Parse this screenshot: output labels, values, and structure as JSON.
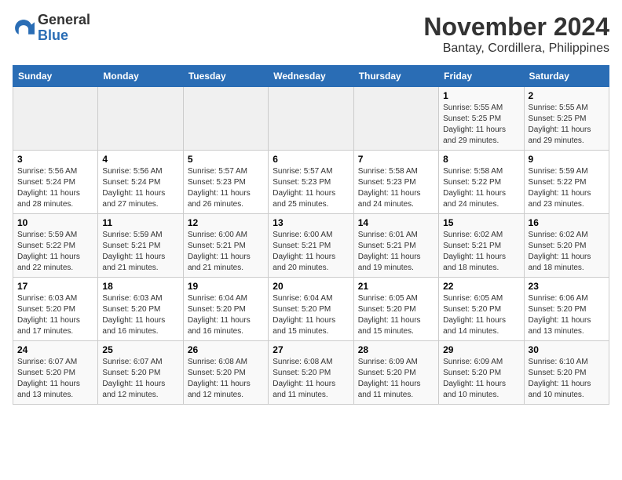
{
  "logo": {
    "general": "General",
    "blue": "Blue"
  },
  "title": {
    "month_year": "November 2024",
    "location": "Bantay, Cordillera, Philippines"
  },
  "weekdays": [
    "Sunday",
    "Monday",
    "Tuesday",
    "Wednesday",
    "Thursday",
    "Friday",
    "Saturday"
  ],
  "weeks": [
    [
      {
        "day": "",
        "info": ""
      },
      {
        "day": "",
        "info": ""
      },
      {
        "day": "",
        "info": ""
      },
      {
        "day": "",
        "info": ""
      },
      {
        "day": "",
        "info": ""
      },
      {
        "day": "1",
        "info": "Sunrise: 5:55 AM\nSunset: 5:25 PM\nDaylight: 11 hours and 29 minutes."
      },
      {
        "day": "2",
        "info": "Sunrise: 5:55 AM\nSunset: 5:25 PM\nDaylight: 11 hours and 29 minutes."
      }
    ],
    [
      {
        "day": "3",
        "info": "Sunrise: 5:56 AM\nSunset: 5:24 PM\nDaylight: 11 hours and 28 minutes."
      },
      {
        "day": "4",
        "info": "Sunrise: 5:56 AM\nSunset: 5:24 PM\nDaylight: 11 hours and 27 minutes."
      },
      {
        "day": "5",
        "info": "Sunrise: 5:57 AM\nSunset: 5:23 PM\nDaylight: 11 hours and 26 minutes."
      },
      {
        "day": "6",
        "info": "Sunrise: 5:57 AM\nSunset: 5:23 PM\nDaylight: 11 hours and 25 minutes."
      },
      {
        "day": "7",
        "info": "Sunrise: 5:58 AM\nSunset: 5:23 PM\nDaylight: 11 hours and 24 minutes."
      },
      {
        "day": "8",
        "info": "Sunrise: 5:58 AM\nSunset: 5:22 PM\nDaylight: 11 hours and 24 minutes."
      },
      {
        "day": "9",
        "info": "Sunrise: 5:59 AM\nSunset: 5:22 PM\nDaylight: 11 hours and 23 minutes."
      }
    ],
    [
      {
        "day": "10",
        "info": "Sunrise: 5:59 AM\nSunset: 5:22 PM\nDaylight: 11 hours and 22 minutes."
      },
      {
        "day": "11",
        "info": "Sunrise: 5:59 AM\nSunset: 5:21 PM\nDaylight: 11 hours and 21 minutes."
      },
      {
        "day": "12",
        "info": "Sunrise: 6:00 AM\nSunset: 5:21 PM\nDaylight: 11 hours and 21 minutes."
      },
      {
        "day": "13",
        "info": "Sunrise: 6:00 AM\nSunset: 5:21 PM\nDaylight: 11 hours and 20 minutes."
      },
      {
        "day": "14",
        "info": "Sunrise: 6:01 AM\nSunset: 5:21 PM\nDaylight: 11 hours and 19 minutes."
      },
      {
        "day": "15",
        "info": "Sunrise: 6:02 AM\nSunset: 5:21 PM\nDaylight: 11 hours and 18 minutes."
      },
      {
        "day": "16",
        "info": "Sunrise: 6:02 AM\nSunset: 5:20 PM\nDaylight: 11 hours and 18 minutes."
      }
    ],
    [
      {
        "day": "17",
        "info": "Sunrise: 6:03 AM\nSunset: 5:20 PM\nDaylight: 11 hours and 17 minutes."
      },
      {
        "day": "18",
        "info": "Sunrise: 6:03 AM\nSunset: 5:20 PM\nDaylight: 11 hours and 16 minutes."
      },
      {
        "day": "19",
        "info": "Sunrise: 6:04 AM\nSunset: 5:20 PM\nDaylight: 11 hours and 16 minutes."
      },
      {
        "day": "20",
        "info": "Sunrise: 6:04 AM\nSunset: 5:20 PM\nDaylight: 11 hours and 15 minutes."
      },
      {
        "day": "21",
        "info": "Sunrise: 6:05 AM\nSunset: 5:20 PM\nDaylight: 11 hours and 15 minutes."
      },
      {
        "day": "22",
        "info": "Sunrise: 6:05 AM\nSunset: 5:20 PM\nDaylight: 11 hours and 14 minutes."
      },
      {
        "day": "23",
        "info": "Sunrise: 6:06 AM\nSunset: 5:20 PM\nDaylight: 11 hours and 13 minutes."
      }
    ],
    [
      {
        "day": "24",
        "info": "Sunrise: 6:07 AM\nSunset: 5:20 PM\nDaylight: 11 hours and 13 minutes."
      },
      {
        "day": "25",
        "info": "Sunrise: 6:07 AM\nSunset: 5:20 PM\nDaylight: 11 hours and 12 minutes."
      },
      {
        "day": "26",
        "info": "Sunrise: 6:08 AM\nSunset: 5:20 PM\nDaylight: 11 hours and 12 minutes."
      },
      {
        "day": "27",
        "info": "Sunrise: 6:08 AM\nSunset: 5:20 PM\nDaylight: 11 hours and 11 minutes."
      },
      {
        "day": "28",
        "info": "Sunrise: 6:09 AM\nSunset: 5:20 PM\nDaylight: 11 hours and 11 minutes."
      },
      {
        "day": "29",
        "info": "Sunrise: 6:09 AM\nSunset: 5:20 PM\nDaylight: 11 hours and 10 minutes."
      },
      {
        "day": "30",
        "info": "Sunrise: 6:10 AM\nSunset: 5:20 PM\nDaylight: 11 hours and 10 minutes."
      }
    ]
  ]
}
